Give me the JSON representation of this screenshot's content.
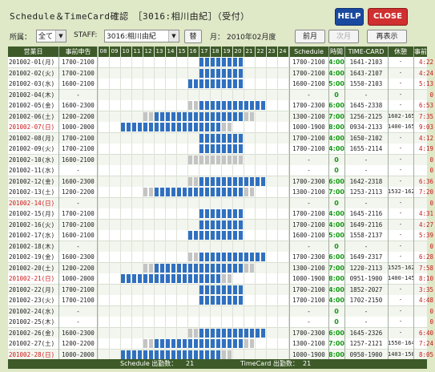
{
  "title": "Schedule＆TimeCard確認　［3016:相川由紀］（受付）",
  "buttons": {
    "help": "HELP",
    "close": "CLOSE"
  },
  "toolbar": {
    "dept_label": "所属：",
    "dept_value": "全て",
    "staff_label": "STAFF:",
    "staff_value": "3016:相川由紀",
    "change_label": "替",
    "month_label": "月：",
    "month_value": "2010年02月度",
    "prev_label": "前月",
    "next_label": "次月",
    "refresh_label": "再表示"
  },
  "headers": {
    "date": "営業日",
    "pre": "事前申告",
    "hours": [
      "08",
      "09",
      "10",
      "11",
      "12",
      "13",
      "14",
      "15",
      "16",
      "17",
      "18",
      "19",
      "20",
      "21",
      "22",
      "23",
      "24"
    ],
    "schedule": "Schedule",
    "time": "時間",
    "timecard": "TIME-CARD",
    "break": "休憩",
    "overtime": "事前"
  },
  "colors": {
    "blue": "#3070c0",
    "gray": "#c4c4c4",
    "header": "#3d5a28",
    "red": "#c41818",
    "green": "#119911"
  },
  "rows": [
    {
      "date": "201002-01(月)",
      "pre": "1700-2100",
      "hol": false,
      "tl": "",
      "sched": "1700-2100",
      "time": "4:00",
      "tc": "1641-2103",
      "brk": "-",
      "ot": "4:22"
    },
    {
      "date": "201002-02(火)",
      "pre": "1700-2100",
      "hol": false,
      "tl": "",
      "sched": "1700-2100",
      "time": "4:00",
      "tc": "1643-2107",
      "brk": "-",
      "ot": "4:24"
    },
    {
      "date": "201002-03(水)",
      "pre": "1600-2100",
      "hol": false,
      "tl": "",
      "sched": "1600-2100",
      "time": "5:00",
      "tc": "1550-2103",
      "brk": "-",
      "ot": "5:13"
    },
    {
      "date": "201002-04(木)",
      "pre": "-",
      "hol": false,
      "tl": "",
      "sched": "-",
      "time": "0",
      "tc": "-",
      "brk": "-",
      "ot": "0"
    },
    {
      "date": "201002-05(金)",
      "pre": "1600-2300",
      "hol": false,
      "tl": "",
      "sched": "1700-2300",
      "time": "6:00",
      "tc": "1645-2338",
      "brk": "-",
      "ot": "6:53"
    },
    {
      "date": "201002-06(土)",
      "pre": "1200-2200",
      "hol": false,
      "tl": "",
      "sched": "1300-2100",
      "time": "7:00",
      "tc": "1256-2125",
      "brk": "1602-1656",
      "ot": "7:35"
    },
    {
      "date": "201002-07(日)",
      "pre": "1000-2000",
      "hol": true,
      "tl": "",
      "sched": "1000-1900",
      "time": "8:00",
      "tc": "0934-2133",
      "brk": "1400-1656",
      "ot": "9:03"
    },
    {
      "date": "201002-08(月)",
      "pre": "1700-2100",
      "hol": false,
      "tl": "",
      "sched": "1700-2100",
      "time": "4:00",
      "tc": "1650-2102",
      "brk": "-",
      "ot": "4:12"
    },
    {
      "date": "201002-09(火)",
      "pre": "1700-2100",
      "hol": false,
      "tl": "",
      "sched": "1700-2100",
      "time": "4:00",
      "tc": "1655-2114",
      "brk": "-",
      "ot": "4:19"
    },
    {
      "date": "201002-10(水)",
      "pre": "1600-2100",
      "hol": false,
      "tl": "",
      "sched": "-",
      "time": "0",
      "tc": "-",
      "brk": "-",
      "ot": "0"
    },
    {
      "date": "201002-11(水)",
      "pre": "-",
      "hol": false,
      "tl": "",
      "sched": "-",
      "time": "0",
      "tc": "-",
      "brk": "-",
      "ot": "0"
    },
    {
      "date": "201002-12(金)",
      "pre": "1600-2300",
      "hol": false,
      "tl": "",
      "sched": "1700-2300",
      "time": "6:00",
      "tc": "1642-2318",
      "brk": "-",
      "ot": "6:36"
    },
    {
      "date": "201002-13(土)",
      "pre": "1200-2200",
      "hol": false,
      "tl": "",
      "sched": "1300-2100",
      "time": "7:00",
      "tc": "1253-2113",
      "brk": "1532-1624",
      "ot": "7:20"
    },
    {
      "date": "201002-14(日)",
      "pre": "-",
      "hol": true,
      "tl": "",
      "sched": "-",
      "time": "0",
      "tc": "-",
      "brk": "-",
      "ot": "0"
    },
    {
      "date": "201002-15(月)",
      "pre": "1700-2100",
      "hol": false,
      "tl": "",
      "sched": "1700-2100",
      "time": "4:00",
      "tc": "1645-2116",
      "brk": "-",
      "ot": "4:31"
    },
    {
      "date": "201002-16(火)",
      "pre": "1700-2100",
      "hol": false,
      "tl": "",
      "sched": "1700-2100",
      "time": "4:00",
      "tc": "1649-2116",
      "brk": "-",
      "ot": "4:27"
    },
    {
      "date": "201002-17(水)",
      "pre": "1600-2100",
      "hol": false,
      "tl": "",
      "sched": "1600-2100",
      "time": "5:00",
      "tc": "1558-2137",
      "brk": "-",
      "ot": "5:39"
    },
    {
      "date": "201002-18(木)",
      "pre": "-",
      "hol": false,
      "tl": "",
      "sched": "-",
      "time": "0",
      "tc": "-",
      "brk": "-",
      "ot": "0"
    },
    {
      "date": "201002-19(金)",
      "pre": "1600-2300",
      "hol": false,
      "tl": "",
      "sched": "1700-2300",
      "time": "6:00",
      "tc": "1649-2317",
      "brk": "-",
      "ot": "6:28"
    },
    {
      "date": "201002-20(土)",
      "pre": "1200-2200",
      "hol": false,
      "tl": "",
      "sched": "1300-2100",
      "time": "7:00",
      "tc": "1220-2113",
      "brk": "1525-1620",
      "ot": "7:58"
    },
    {
      "date": "201002-21(日)",
      "pre": "1000-2000",
      "hol": true,
      "tl": "",
      "sched": "1000-1900",
      "time": "8:00",
      "tc": "0951-1900",
      "brk": "1400-1459",
      "ot": "8:10"
    },
    {
      "date": "201002-22(月)",
      "pre": "1700-2100",
      "hol": false,
      "tl": "",
      "sched": "1700-2100",
      "time": "4:00",
      "tc": "1852-2027",
      "brk": "-",
      "ot": "3:35"
    },
    {
      "date": "201002-23(火)",
      "pre": "1700-2100",
      "hol": false,
      "tl": "",
      "sched": "1700-2100",
      "time": "4:00",
      "tc": "1702-2150",
      "brk": "-",
      "ot": "4:48"
    },
    {
      "date": "201002-24(水)",
      "pre": "-",
      "hol": false,
      "tl": "",
      "sched": "-",
      "time": "0",
      "tc": "-",
      "brk": "-",
      "ot": "0"
    },
    {
      "date": "201002-25(木)",
      "pre": "-",
      "hol": false,
      "tl": "",
      "sched": "-",
      "time": "0",
      "tc": "-",
      "brk": "-",
      "ot": "0"
    },
    {
      "date": "201002-26(金)",
      "pre": "1600-2300",
      "hol": false,
      "tl": "",
      "sched": "1700-2300",
      "time": "6:00",
      "tc": "1645-2326",
      "brk": "-",
      "ot": "6:40"
    },
    {
      "date": "201002-27(土)",
      "pre": "1200-2200",
      "hol": false,
      "tl": "",
      "sched": "1300-2100",
      "time": "7:00",
      "tc": "1257-2121",
      "brk": "1550-1640",
      "ot": "7:24"
    },
    {
      "date": "201002-28(日)",
      "pre": "1000-2000",
      "hol": true,
      "tl": "",
      "sched": "1000-1900",
      "time": "8:00",
      "tc": "0950-1900",
      "brk": "1403-1500",
      "ot": "8:05"
    }
  ],
  "footer": {
    "sched_label": "Schedule 出勤数：",
    "sched_count": "21",
    "tc_label": "TimeCard 出勤数：",
    "tc_count": "21"
  }
}
